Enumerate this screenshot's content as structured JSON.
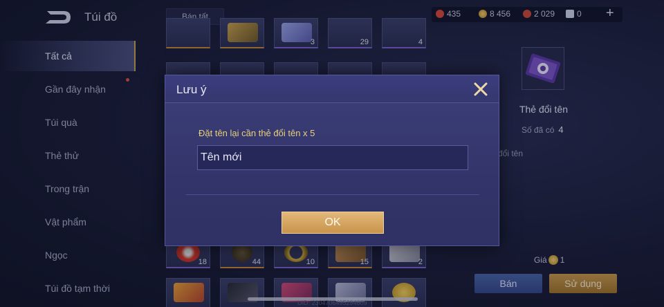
{
  "header": {
    "title": "Túi đồ",
    "sell_all_label": "Bán tất",
    "currencies": [
      {
        "icon": "red-gem-icon",
        "value": "435",
        "color": "#d9473c"
      },
      {
        "icon": "gold-coin-icon",
        "value": "8 456",
        "color": "#d4a43a"
      },
      {
        "icon": "red-coin-icon",
        "value": "2 029",
        "color": "#c94a3a"
      },
      {
        "icon": "voucher-icon",
        "value": "0",
        "color": "#cfd3ea"
      }
    ],
    "plus_icon": "plus-icon"
  },
  "sidebar": {
    "items": [
      {
        "label": "Tất cả",
        "active": true
      },
      {
        "label": "Gần đây nhận",
        "badge": true
      },
      {
        "label": "Túi quà"
      },
      {
        "label": "Thẻ thử"
      },
      {
        "label": "Trong trận"
      },
      {
        "label": "Vật phẩm"
      },
      {
        "label": "Ngọc"
      },
      {
        "label": "Túi đồ tạm thời"
      }
    ]
  },
  "grid": {
    "row_top_qty": [
      "",
      "",
      "3",
      "29",
      "4"
    ],
    "row_bottom_qty": [
      "18",
      "44",
      "10",
      "15",
      "2"
    ]
  },
  "detail": {
    "item_name": "Thẻ đổi tên",
    "owned_label": "Số đã có",
    "owned_value": "4",
    "description_fragment": "đổi tên",
    "price_label": "Giá",
    "price_value": "1",
    "sell_label": "Bán",
    "use_label": "Sử dụng"
  },
  "footer": {
    "uid_text": "UID: 2304706495294609"
  },
  "modal": {
    "title": "Lưu ý",
    "message": "Đặt tên lại cần thẻ đổi tên x 5",
    "input_value": "Tên mới",
    "ok_label": "OK"
  }
}
